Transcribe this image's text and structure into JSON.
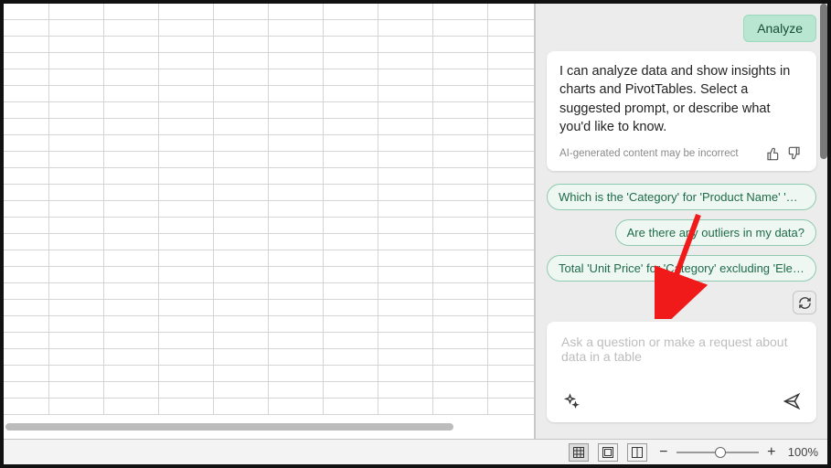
{
  "panel": {
    "analyze_label": "Analyze",
    "intro_text": "I can analyze data and show insights in charts and PivotTables. Select a suggested prompt, or describe what you'd like to know.",
    "disclaimer": "AI-generated content may be incorrect",
    "suggestions": [
      "Which is the 'Category' for 'Product Name' 'Widget A'",
      "Are there any outliers in my data?",
      "Total 'Unit Price' for 'Category' excluding 'Electronics'"
    ],
    "input_placeholder": "Ask a question or make a request about data in a table",
    "input_value": ""
  },
  "statusbar": {
    "zoom_label": "100%",
    "minus": "−",
    "plus": "+"
  }
}
